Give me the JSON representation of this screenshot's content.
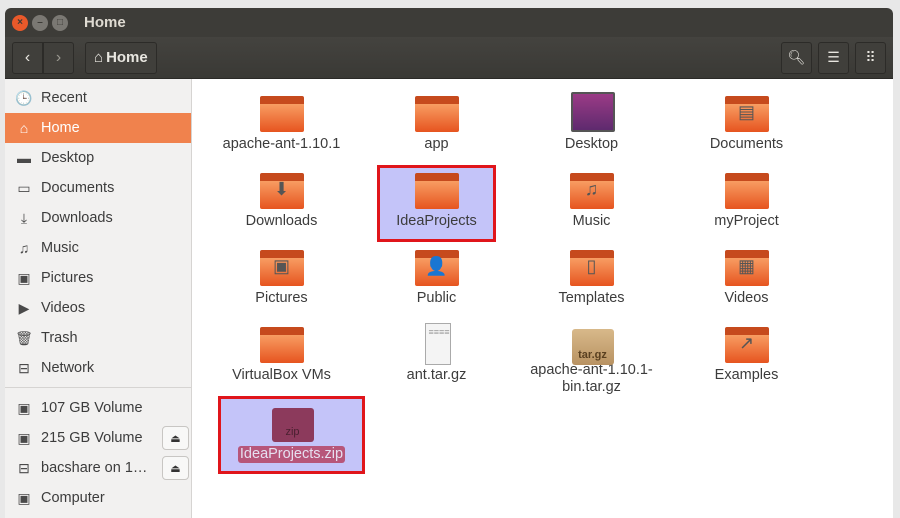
{
  "window": {
    "title": "Home"
  },
  "toolbar": {
    "back": "‹",
    "forward": "›",
    "breadcrumb": "Home",
    "search_icon": "search-icon",
    "list_icon": "list-view-icon",
    "grid_icon": "grid-view-icon"
  },
  "sidebar": {
    "places": [
      {
        "label": "Recent",
        "icon": "🕒"
      },
      {
        "label": "Home",
        "icon": "⌂",
        "active": true
      },
      {
        "label": "Desktop",
        "icon": "▬"
      },
      {
        "label": "Documents",
        "icon": "▭"
      },
      {
        "label": "Downloads",
        "icon": "⤓"
      },
      {
        "label": "Music",
        "icon": "♫"
      },
      {
        "label": "Pictures",
        "icon": "▣"
      },
      {
        "label": "Videos",
        "icon": "▶"
      },
      {
        "label": "Trash",
        "icon": "🗑"
      },
      {
        "label": "Network",
        "icon": "⊟"
      }
    ],
    "devices": [
      {
        "label": "107 GB Volume",
        "icon": "▣"
      },
      {
        "label": "215 GB Volume",
        "icon": "▣",
        "eject": "⏏"
      },
      {
        "label": "bacshare on 1…",
        "icon": "⊟",
        "eject": "⏏"
      },
      {
        "label": "Computer",
        "icon": "▣"
      }
    ]
  },
  "files": [
    {
      "name": "apache-ant-1.10.1",
      "type": "folder"
    },
    {
      "name": "app",
      "type": "folder"
    },
    {
      "name": "Desktop",
      "type": "desktop"
    },
    {
      "name": "Documents",
      "type": "folder",
      "emblem": "▤"
    },
    {
      "name": "Downloads",
      "type": "folder",
      "emblem": "⬇"
    },
    {
      "name": "IdeaProjects",
      "type": "folder",
      "selected": true
    },
    {
      "name": "Music",
      "type": "folder",
      "emblem": "♫"
    },
    {
      "name": "myProject",
      "type": "folder"
    },
    {
      "name": "Pictures",
      "type": "folder",
      "emblem": "▣"
    },
    {
      "name": "Public",
      "type": "folder",
      "emblem": "👤"
    },
    {
      "name": "Templates",
      "type": "folder",
      "emblem": "▯"
    },
    {
      "name": "Videos",
      "type": "folder",
      "emblem": "▦"
    },
    {
      "name": "VirtualBox VMs",
      "type": "folder"
    },
    {
      "name": "ant.tar.gz",
      "type": "doc"
    },
    {
      "name": "apache-ant-1.10.1-bin.tar.gz",
      "type": "archive",
      "badge": "tar.gz"
    },
    {
      "name": "Examples",
      "type": "folder",
      "emblem": "↗"
    },
    {
      "name": "IdeaProjects.zip",
      "type": "zip",
      "badge": "zip",
      "selected": true
    }
  ],
  "colors": {
    "accent": "#f0824d",
    "selection": "#c4c4f9",
    "highlight_border": "#e0151b"
  }
}
